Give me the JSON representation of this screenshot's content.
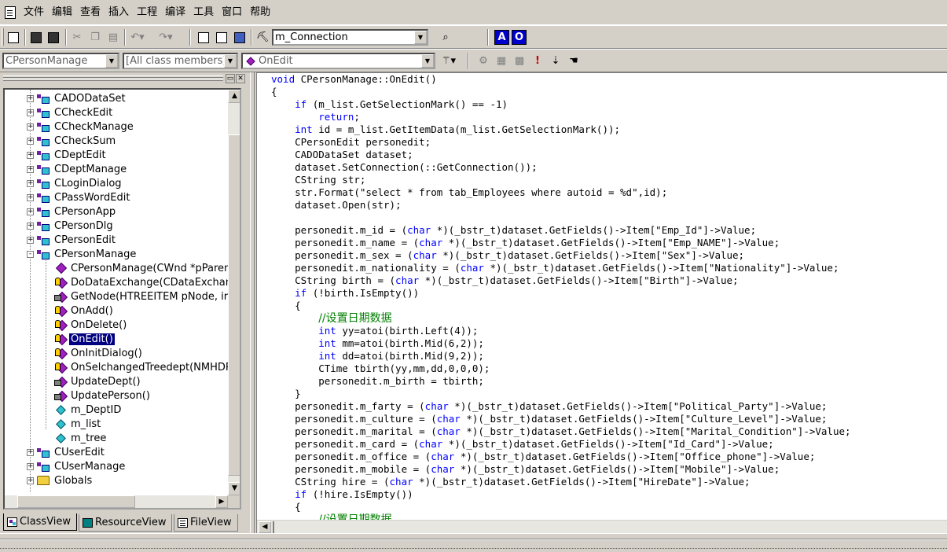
{
  "menu": {
    "items": [
      "文件",
      "编辑",
      "查看",
      "插入",
      "工程",
      "编译",
      "工具",
      "窗口",
      "帮助"
    ]
  },
  "toolbar": {
    "find_combo_value": "m_Connection",
    "ab_left": "A",
    "ab_right": "O"
  },
  "wizardbar": {
    "class_combo": "CPersonManage",
    "filter_combo": "[All class members]",
    "member_combo": "OnEdit"
  },
  "tree": {
    "rows": [
      {
        "label": "CADODataSet",
        "kind": "class",
        "expander": "+"
      },
      {
        "label": "CCheckEdit",
        "kind": "class",
        "expander": "+"
      },
      {
        "label": "CCheckManage",
        "kind": "class",
        "expander": "+"
      },
      {
        "label": "CCheckSum",
        "kind": "class",
        "expander": "+"
      },
      {
        "label": "CDeptEdit",
        "kind": "class",
        "expander": "+"
      },
      {
        "label": "CDeptManage",
        "kind": "class",
        "expander": "+"
      },
      {
        "label": "CLoginDialog",
        "kind": "class",
        "expander": "+"
      },
      {
        "label": "CPassWordEdit",
        "kind": "class",
        "expander": "+"
      },
      {
        "label": "CPersonApp",
        "kind": "class",
        "expander": "+"
      },
      {
        "label": "CPersonDlg",
        "kind": "class",
        "expander": "+"
      },
      {
        "label": "CPersonEdit",
        "kind": "class",
        "expander": "+"
      },
      {
        "label": "CPersonManage",
        "kind": "class",
        "expander": "-"
      },
      {
        "label": "CPersonManage(CWnd *pParen",
        "kind": "pub"
      },
      {
        "label": "DoDataExchange(CDataExchan",
        "kind": "prot"
      },
      {
        "label": "GetNode(HTREEITEM pNode, ir",
        "kind": "priv"
      },
      {
        "label": "OnAdd()",
        "kind": "prot"
      },
      {
        "label": "OnDelete()",
        "kind": "prot"
      },
      {
        "label": "OnEdit()",
        "kind": "prot",
        "selected": true
      },
      {
        "label": "OnInitDialog()",
        "kind": "prot"
      },
      {
        "label": "OnSelchangedTreedept(NMHDR",
        "kind": "prot"
      },
      {
        "label": "UpdateDept()",
        "kind": "priv"
      },
      {
        "label": "UpdatePerson()",
        "kind": "priv"
      },
      {
        "label": "m_DeptID",
        "kind": "var"
      },
      {
        "label": "m_list",
        "kind": "var"
      },
      {
        "label": "m_tree",
        "kind": "var"
      },
      {
        "label": "CUserEdit",
        "kind": "class",
        "expander": "+"
      },
      {
        "label": "CUserManage",
        "kind": "class",
        "expander": "+"
      },
      {
        "label": "Globals",
        "kind": "folder",
        "expander": "+"
      }
    ]
  },
  "tabs": [
    {
      "label": "ClassView",
      "icon": "classview-icon",
      "active": true
    },
    {
      "label": "ResourceView",
      "icon": "resourceview-icon"
    },
    {
      "label": "FileView",
      "icon": "fileview-icon"
    }
  ],
  "code": {
    "lines": [
      [
        [
          "kw",
          "void"
        ],
        [
          "t",
          " CPersonManage::OnEdit()"
        ]
      ],
      [
        [
          "t",
          "{"
        ]
      ],
      [
        [
          "t",
          "    "
        ],
        [
          "kw",
          "if"
        ],
        [
          "t",
          " (m_list.GetSelectionMark() == -1)"
        ]
      ],
      [
        [
          "t",
          "        "
        ],
        [
          "kw",
          "return"
        ],
        [
          "t",
          ";"
        ]
      ],
      [
        [
          "t",
          "    "
        ],
        [
          "kw",
          "int"
        ],
        [
          "t",
          " id = m_list.GetItemData(m_list.GetSelectionMark());"
        ]
      ],
      [
        [
          "t",
          "    CPersonEdit personedit;"
        ]
      ],
      [
        [
          "t",
          "    CADODataSet dataset;"
        ]
      ],
      [
        [
          "t",
          "    dataset.SetConnection(::GetConnection());"
        ]
      ],
      [
        [
          "t",
          "    CString str;"
        ]
      ],
      [
        [
          "t",
          "    str.Format(\"select * from tab_Employees where autoid = %d\",id);"
        ]
      ],
      [
        [
          "t",
          "    dataset.Open(str);"
        ]
      ],
      [
        [
          "t",
          ""
        ]
      ],
      [
        [
          "t",
          "    personedit.m_id = ("
        ],
        [
          "kw",
          "char"
        ],
        [
          "t",
          " *)(_bstr_t)dataset.GetFields()->Item[\"Emp_Id\"]->Value;"
        ]
      ],
      [
        [
          "t",
          "    personedit.m_name = ("
        ],
        [
          "kw",
          "char"
        ],
        [
          "t",
          " *)(_bstr_t)dataset.GetFields()->Item[\"Emp_NAME\"]->Value;"
        ]
      ],
      [
        [
          "t",
          "    personedit.m_sex = ("
        ],
        [
          "kw",
          "char"
        ],
        [
          "t",
          " *)(_bstr_t)dataset.GetFields()->Item[\"Sex\"]->Value;"
        ]
      ],
      [
        [
          "t",
          "    personedit.m_nationality = ("
        ],
        [
          "kw",
          "char"
        ],
        [
          "t",
          " *)(_bstr_t)dataset.GetFields()->Item[\"Nationality\"]->Value;"
        ]
      ],
      [
        [
          "t",
          "    CString birth = ("
        ],
        [
          "kw",
          "char"
        ],
        [
          "t",
          " *)(_bstr_t)dataset.GetFields()->Item[\"Birth\"]->Value;"
        ]
      ],
      [
        [
          "t",
          "    "
        ],
        [
          "kw",
          "if"
        ],
        [
          "t",
          " (!birth.IsEmpty())"
        ]
      ],
      [
        [
          "t",
          "    {"
        ]
      ],
      [
        [
          "t",
          "        "
        ],
        [
          "cm",
          "//设置日期数据"
        ]
      ],
      [
        [
          "t",
          "        "
        ],
        [
          "kw",
          "int"
        ],
        [
          "t",
          " yy=atoi(birth.Left(4));"
        ]
      ],
      [
        [
          "t",
          "        "
        ],
        [
          "kw",
          "int"
        ],
        [
          "t",
          " mm=atoi(birth.Mid(6,2));"
        ]
      ],
      [
        [
          "t",
          "        "
        ],
        [
          "kw",
          "int"
        ],
        [
          "t",
          " dd=atoi(birth.Mid(9,2));"
        ]
      ],
      [
        [
          "t",
          "        CTime tbirth(yy,mm,dd,0,0,0);"
        ]
      ],
      [
        [
          "t",
          "        personedit.m_birth = tbirth;"
        ]
      ],
      [
        [
          "t",
          "    }"
        ]
      ],
      [
        [
          "t",
          "    personedit.m_farty = ("
        ],
        [
          "kw",
          "char"
        ],
        [
          "t",
          " *)(_bstr_t)dataset.GetFields()->Item[\"Political_Party\"]->Value;"
        ]
      ],
      [
        [
          "t",
          "    personedit.m_culture = ("
        ],
        [
          "kw",
          "char"
        ],
        [
          "t",
          " *)(_bstr_t)dataset.GetFields()->Item[\"Culture_Level\"]->Value;"
        ]
      ],
      [
        [
          "t",
          "    personedit.m_marital = ("
        ],
        [
          "kw",
          "char"
        ],
        [
          "t",
          " *)(_bstr_t)dataset.GetFields()->Item[\"Marital_Condition\"]->Value;"
        ]
      ],
      [
        [
          "t",
          "    personedit.m_card = ("
        ],
        [
          "kw",
          "char"
        ],
        [
          "t",
          " *)(_bstr_t)dataset.GetFields()->Item[\"Id_Card\"]->Value;"
        ]
      ],
      [
        [
          "t",
          "    personedit.m_office = ("
        ],
        [
          "kw",
          "char"
        ],
        [
          "t",
          " *)(_bstr_t)dataset.GetFields()->Item[\"Office_phone\"]->Value;"
        ]
      ],
      [
        [
          "t",
          "    personedit.m_mobile = ("
        ],
        [
          "kw",
          "char"
        ],
        [
          "t",
          " *)(_bstr_t)dataset.GetFields()->Item[\"Mobile\"]->Value;"
        ]
      ],
      [
        [
          "t",
          "    CString hire = ("
        ],
        [
          "kw",
          "char"
        ],
        [
          "t",
          " *)(_bstr_t)dataset.GetFields()->Item[\"HireDate\"]->Value;"
        ]
      ],
      [
        [
          "t",
          "    "
        ],
        [
          "kw",
          "if"
        ],
        [
          "t",
          " (!hire.IsEmpty())"
        ]
      ],
      [
        [
          "t",
          "    {"
        ]
      ],
      [
        [
          "t",
          "        "
        ],
        [
          "cm",
          "//设置日期数据"
        ]
      ]
    ]
  },
  "colors": {
    "keyword": "#0000ff",
    "comment": "#008000",
    "selection": "#000080",
    "chrome": "#d4d0c8"
  }
}
